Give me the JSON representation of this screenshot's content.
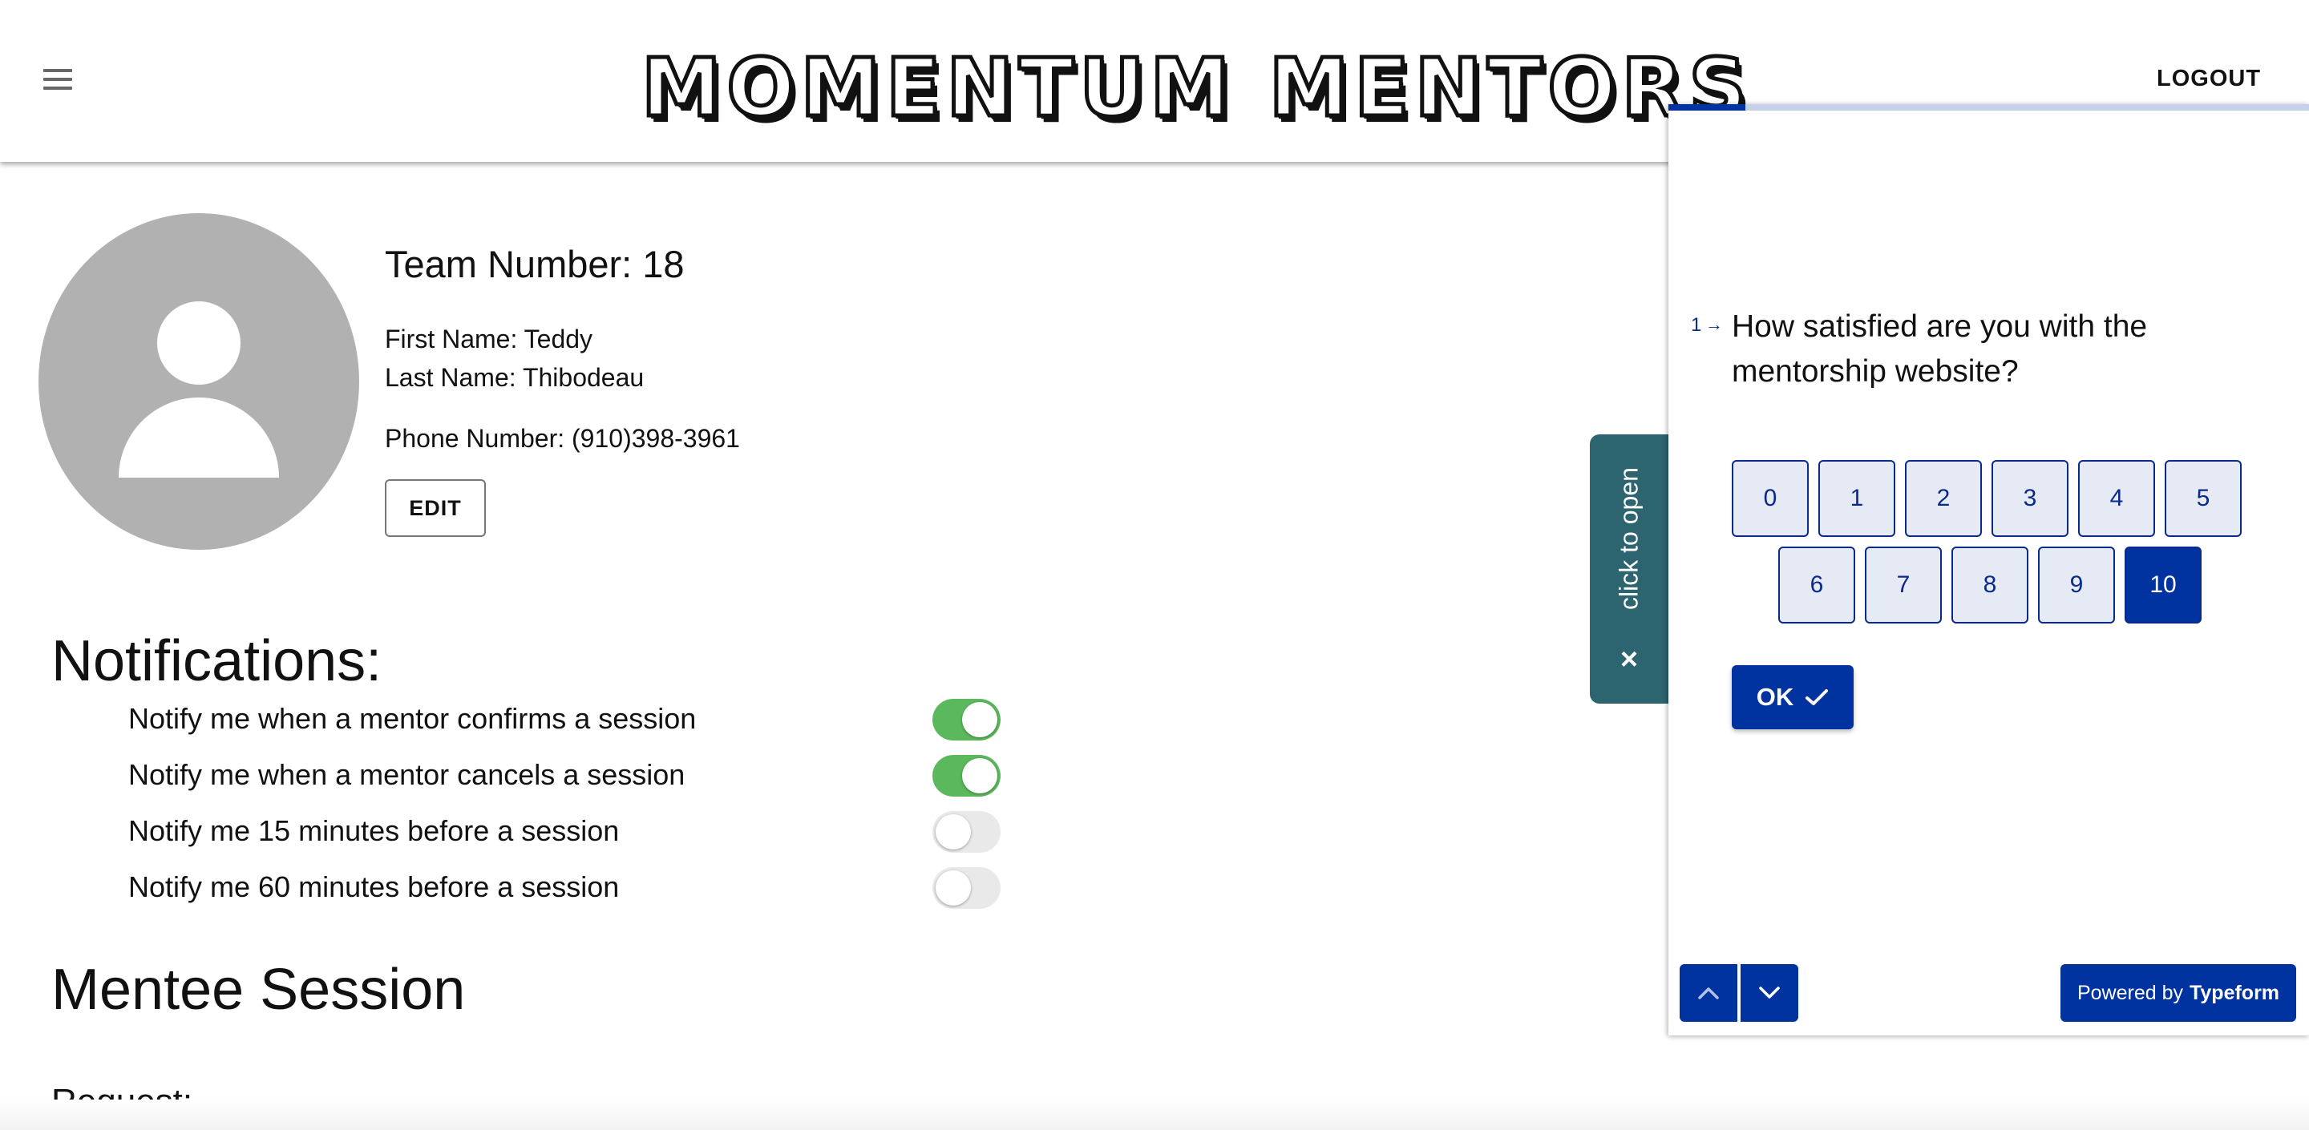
{
  "header": {
    "logo_text": "MOMENTUM MENTORS",
    "logout_label": "LOGOUT"
  },
  "profile": {
    "team_number": "Team Number: 18",
    "first_name": "First Name: Teddy",
    "last_name": "Last Name: Thibodeau",
    "phone": "Phone Number: (910)398-3961",
    "edit_label": "EDIT"
  },
  "notifications": {
    "title": "Notifications:",
    "items": [
      {
        "label": "Notify me when a mentor confirms a session",
        "enabled": true
      },
      {
        "label": "Notify me when a mentor cancels a session",
        "enabled": true
      },
      {
        "label": "Notify me 15 minutes before a session",
        "enabled": false
      },
      {
        "label": "Notify me 60 minutes before a session",
        "enabled": false
      }
    ]
  },
  "mentee_session": {
    "title": "Mentee Session",
    "request_label": "Request:"
  },
  "side_tab": {
    "label": "click to open",
    "close_glyph": "×"
  },
  "typeform": {
    "progress": 0.12,
    "question_number": "1",
    "question_arrow": "→",
    "question": "How satisfied are you with the mentorship website?",
    "options": [
      "0",
      "1",
      "2",
      "3",
      "4",
      "5",
      "6",
      "7",
      "8",
      "9",
      "10"
    ],
    "selected": "10",
    "ok_label": "OK",
    "powered_prefix": "Powered by",
    "powered_brand": "Typeform"
  },
  "colors": {
    "typeform_blue": "#0033a0",
    "toggle_on": "#5cb85c",
    "side_tab": "#2c6470",
    "avatar_gray": "#b1b1b1"
  }
}
